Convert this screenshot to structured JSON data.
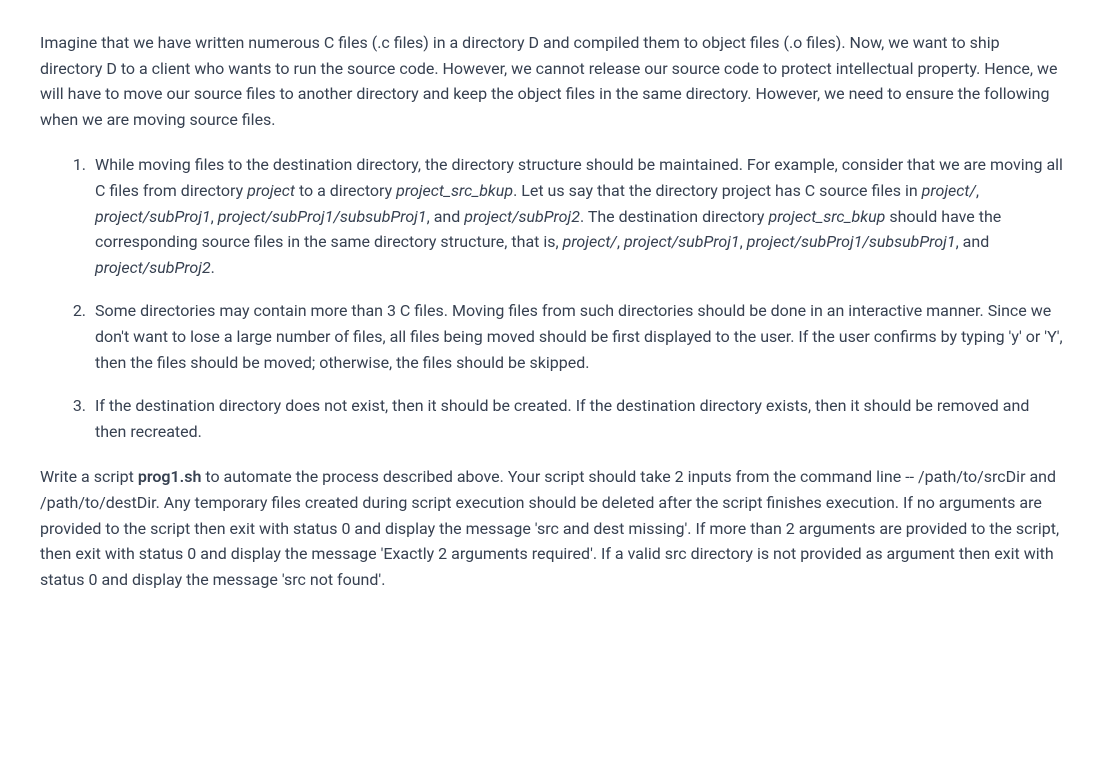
{
  "intro": {
    "text_part1": "Imagine that we have written numerous C files (.c files) in a directory D and compiled them to object files (.o files). Now, we want to ship directory D to a client who wants to run the source code. However, we cannot release our source code to protect intellectual property. Hence, we will have to move our source files to another directory and keep the object files in the same directory. However, we need to ensure the following when we are moving source files."
  },
  "list": {
    "item1": {
      "t1": "While moving files to the destination directory, the directory structure should be maintained. For example, consider that we are moving all C files from directory ",
      "e1": "project",
      "t2": " to a directory ",
      "e2": "project_src_bkup",
      "t3": ". Let us say that the directory project has C source files in ",
      "e3": "project/",
      "t4": ", ",
      "e4": "project/subProj1",
      "t5": ", ",
      "e5": "project/subProj1/subsubProj1",
      "t6": ", and ",
      "e6": "project/subProj2",
      "t7": ". The destination directory ",
      "e7": "project_src_bkup",
      "t8": " should have the corresponding source files in the same directory structure, that is, ",
      "e8": "project/",
      "t9": ", ",
      "e9": "project/subProj1",
      "t10": ", ",
      "e10": "project/subProj1/subsubProj1",
      "t11": ", and ",
      "e11": "project/subProj2",
      "t12": "."
    },
    "item2": {
      "text": "Some directories may contain more than 3 C files. Moving files from such directories should be done in an interactive manner. Since we don't want to lose a large number of files, all files being moved should be first displayed to the user. If the user confirms by typing 'y' or 'Y', then the files should be moved; otherwise, the files should be skipped."
    },
    "item3": {
      "text": "If the destination directory does not exist, then it should be created. If the destination directory exists, then it should be removed and then recreated."
    }
  },
  "closing": {
    "t1": "Write a script ",
    "s1": "prog1.sh",
    "t2": " to automate the process described above. Your script should take 2 inputs from the command line -- /path/to/srcDir and /path/to/destDir. Any temporary files created during script execution should be deleted after the script finishes execution. If no arguments are provided to the script then exit with status 0 and display the message 'src and dest missing'. If more than 2 arguments are provided to the script, then exit with status 0 and display the message 'Exactly 2 arguments required'. If a valid src directory is not provided as argument then exit with status 0 and display the message 'src not found'."
  }
}
